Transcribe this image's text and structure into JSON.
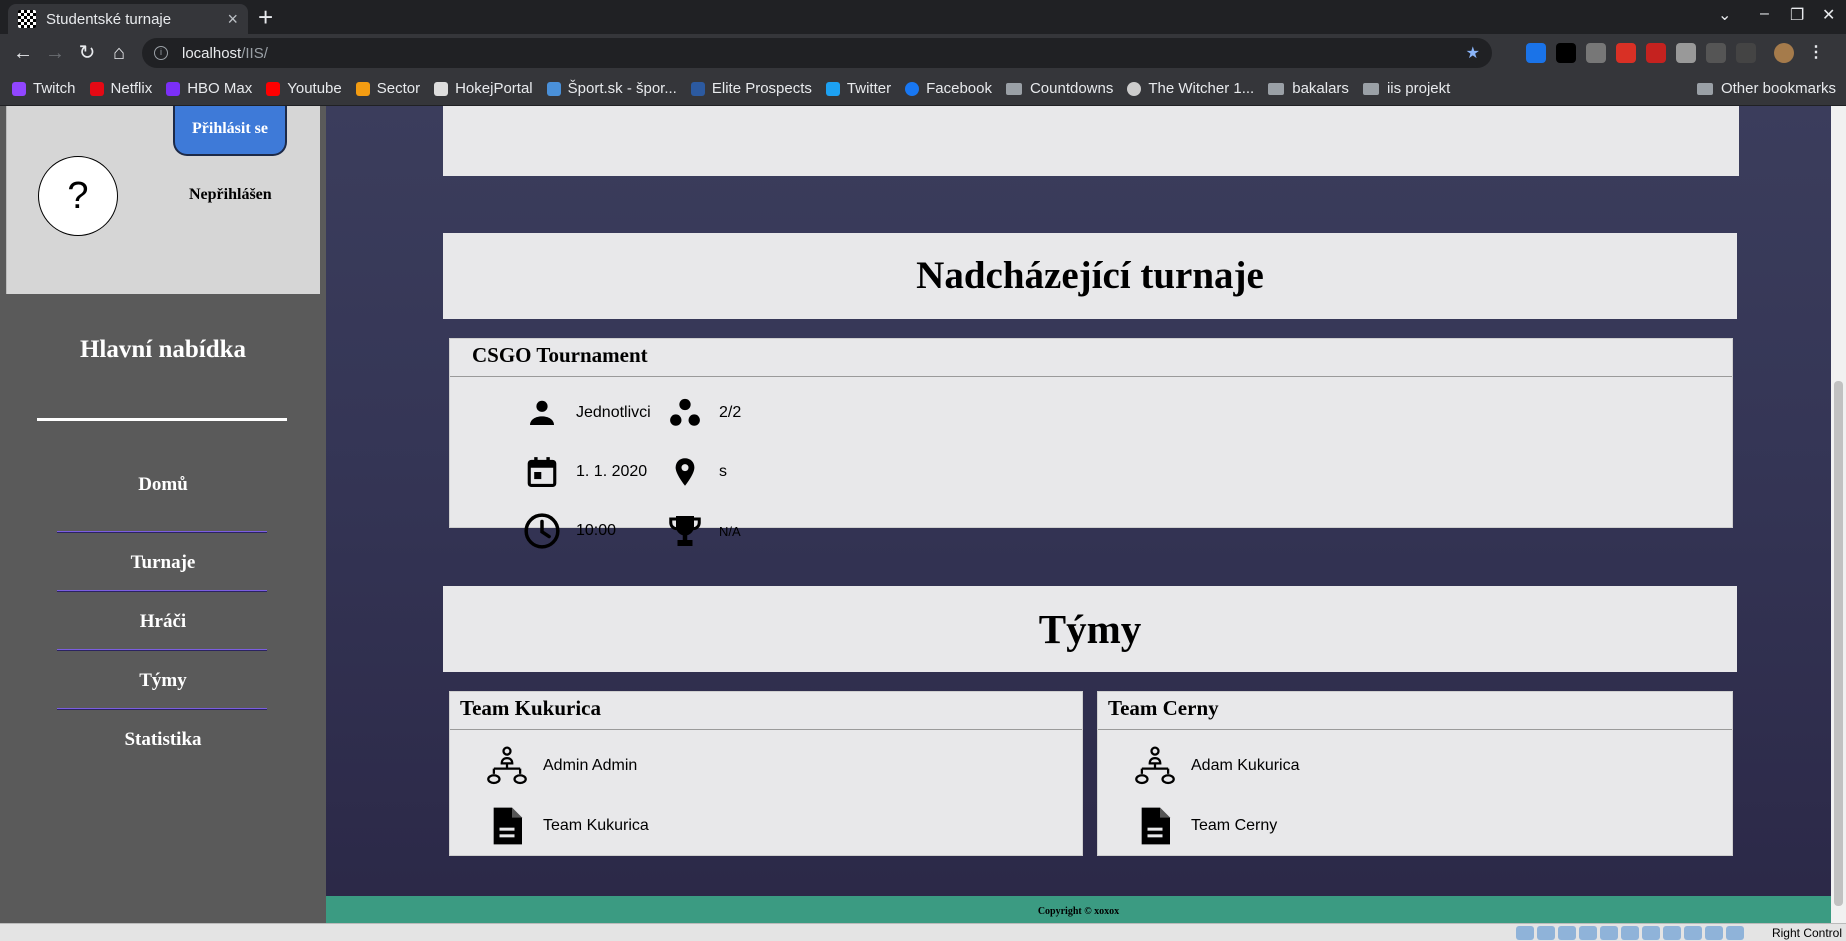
{
  "browser": {
    "tab_title": "Studentské turnaje",
    "tab_close": "×",
    "new_tab": "+",
    "url_host": "localhost",
    "url_path": "/IIS/",
    "bookmarks": [
      {
        "label": "Twitch",
        "color": "#9146ff"
      },
      {
        "label": "Netflix",
        "color": "#e50914"
      },
      {
        "label": "HBO Max",
        "color": "#7b2ff7"
      },
      {
        "label": "Youtube",
        "color": "#ff0000"
      },
      {
        "label": "Sector",
        "color": "#f39c12"
      },
      {
        "label": "HokejPortal",
        "color": "#dddddd"
      },
      {
        "label": "Šport.sk - špor...",
        "color": "#4a90d9"
      },
      {
        "label": "Elite Prospects",
        "color": "#2c5aa0"
      },
      {
        "label": "Twitter",
        "color": "#1da1f2"
      },
      {
        "label": "Facebook",
        "color": "#1877f2"
      },
      {
        "label": "Countdowns",
        "folder": true
      },
      {
        "label": "The Witcher 1...",
        "color": "#cccccc"
      },
      {
        "label": "bakalars",
        "folder": true
      },
      {
        "label": "iis projekt",
        "folder": true
      }
    ],
    "other_bookmarks": "Other bookmarks"
  },
  "sidebar": {
    "login_button": "Přihlásit se",
    "avatar_placeholder": "?",
    "login_status": "Nepřihlášen",
    "menu_title": "Hlavní nabídka",
    "menu_items": [
      "Domů",
      "Turnaje",
      "Hráči",
      "Týmy",
      "Statistika"
    ]
  },
  "upcoming": {
    "heading": "Nadcházející turnaje",
    "tournament": {
      "name": "CSGO Tournament",
      "type": "Jednotlivci",
      "capacity": "2/2",
      "date": "1. 1. 2020",
      "location": "s",
      "time": "10:00",
      "prize": "N/A"
    }
  },
  "teams": {
    "heading": "Týmy",
    "list": [
      {
        "name": "Team Kukurica",
        "leader": "Admin Admin",
        "description": "Team Kukurica"
      },
      {
        "name": "Team Cerny",
        "leader": "Adam Kukurica",
        "description": "Team Cerny"
      }
    ]
  },
  "footer": {
    "copyright": "Copyright © xoxox"
  },
  "taskbar": {
    "right_control": "Right Control"
  }
}
